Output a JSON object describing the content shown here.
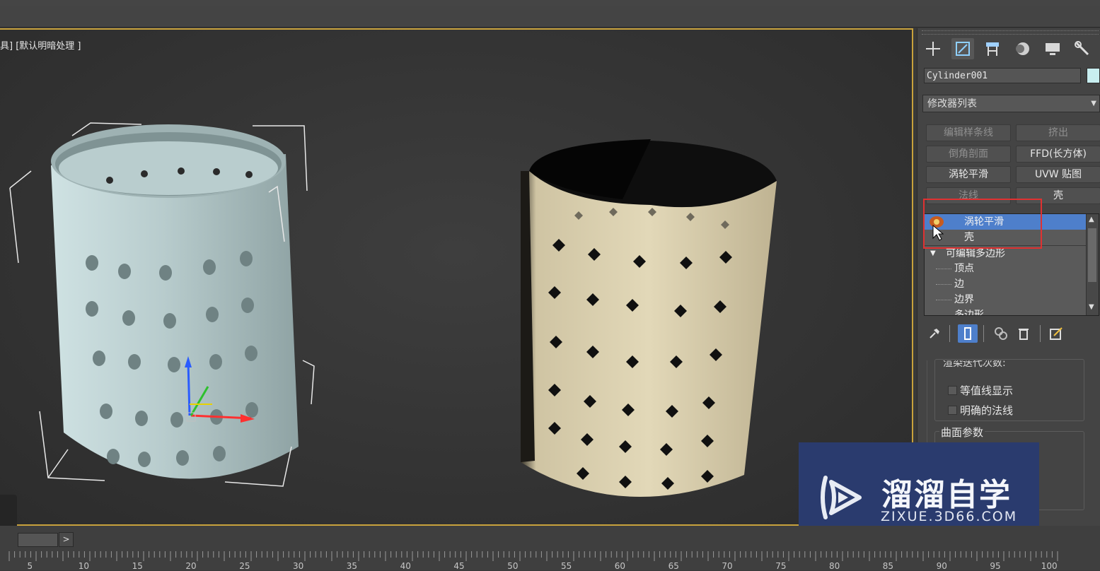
{
  "viewport": {
    "label": "具] [默认明暗处理 ]",
    "border_color": "#c8a23c",
    "objects": [
      "cylinder-left-smooth",
      "cylinder-right-faceted"
    ]
  },
  "command_panel": {
    "tabs": [
      "create-icon",
      "modify-icon",
      "hierarchy-icon",
      "motion-icon",
      "display-icon",
      "utilities-icon"
    ],
    "object_name": "Cylinder001",
    "object_color": "#c8eef0",
    "modifier_list_label": "修改器列表",
    "modifier_buttons": [
      {
        "label": "编辑样条线",
        "enabled": false
      },
      {
        "label": "挤出",
        "enabled": false
      },
      {
        "label": "倒角剖面",
        "enabled": false
      },
      {
        "label": "FFD(长方体)",
        "enabled": true
      },
      {
        "label": "涡轮平滑",
        "enabled": true
      },
      {
        "label": "UVW 贴图",
        "enabled": true
      },
      {
        "label": "法线",
        "enabled": false
      },
      {
        "label": "壳",
        "enabled": true
      }
    ],
    "stack": [
      {
        "label": "涡轮平滑",
        "selected": true
      },
      {
        "label": "壳",
        "selected": false
      },
      {
        "label": "可编辑多边形",
        "selected": false
      },
      {
        "label": "顶点",
        "selected": false
      },
      {
        "label": "边",
        "selected": false
      },
      {
        "label": "边界",
        "selected": false
      },
      {
        "label": "多边形",
        "selected": false
      }
    ],
    "stack_tools": [
      "pin-stack-icon",
      "show-end-result-icon",
      "make-unique-icon",
      "remove-modifier-icon",
      "configure-sets-icon"
    ],
    "rollout": {
      "partial_label": "渲染迭代次数:",
      "checkbox_isoline": "等值线显示",
      "checkbox_explicit_normals": "明确的法线",
      "group_surface": "曲面参数"
    }
  },
  "watermark": {
    "title": "溜溜自学",
    "url": "ZIXUE.3D66.COM",
    "bg_color": "#2a3b6e"
  },
  "timeline": {
    "next_label": ">",
    "ticks": [
      "5",
      "10",
      "15",
      "20",
      "25",
      "30",
      "35",
      "40",
      "45",
      "50",
      "55",
      "60",
      "65",
      "70",
      "75",
      "80",
      "85",
      "90",
      "95",
      "100"
    ]
  }
}
